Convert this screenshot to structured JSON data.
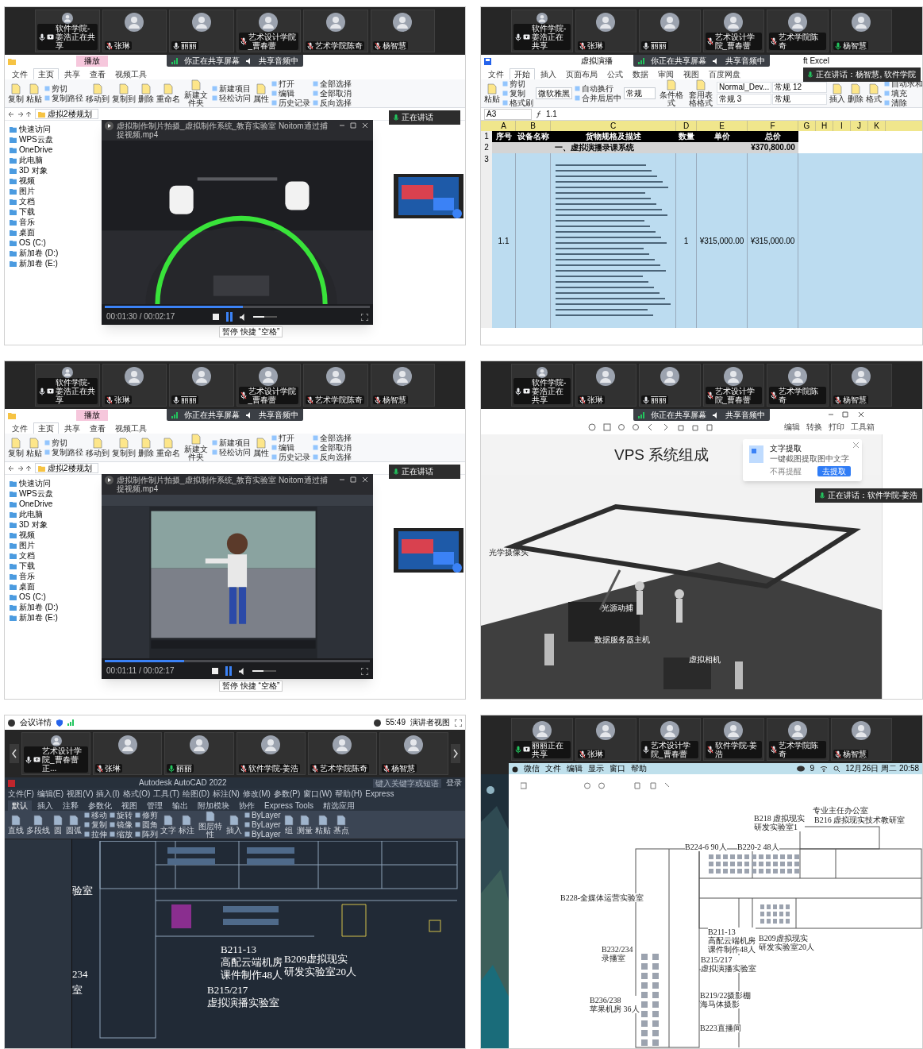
{
  "panels": [
    {
      "kind": "explorer_video",
      "participants": [
        {
          "name": "软件学院-姜浩正在共享",
          "muted": false,
          "speaking": false,
          "sharing": true
        },
        {
          "name": "张琳",
          "muted": true,
          "speaking": false,
          "sharing": false
        },
        {
          "name": "丽丽",
          "muted": false,
          "speaking": false,
          "sharing": false
        },
        {
          "name": "艺术设计学院_曹春蕾",
          "muted": true,
          "speaking": false,
          "sharing": false
        },
        {
          "name": "艺术学院陈奇",
          "muted": true,
          "speaking": false,
          "sharing": false
        },
        {
          "name": "杨智慧",
          "muted": true,
          "speaking": false,
          "sharing": false
        }
      ],
      "share_banner": [
        "你正在共享屏幕",
        "共享音频中"
      ],
      "context_tab": "播放",
      "ribbon_tabs": [
        {
          "label": "文件",
          "selected": false
        },
        {
          "label": "主页",
          "selected": true
        },
        {
          "label": "共享",
          "selected": false
        },
        {
          "label": "查看",
          "selected": false
        },
        {
          "label": "视频工具",
          "selected": false
        }
      ],
      "ribbon": [
        {
          "kind": "large",
          "label": "复制"
        },
        {
          "kind": "large",
          "label": "粘贴"
        },
        {
          "kind": "stack",
          "items": [
            "剪切",
            "复制路径"
          ]
        },
        {
          "kind": "large",
          "label": "移动到"
        },
        {
          "kind": "large",
          "label": "复制到"
        },
        {
          "kind": "large",
          "label": "删除"
        },
        {
          "kind": "large",
          "label": "重命名"
        },
        {
          "kind": "large",
          "label": "新建文件夹"
        },
        {
          "kind": "stack",
          "items": [
            "新建项目",
            "轻松访问"
          ]
        },
        {
          "kind": "large",
          "label": "属性"
        },
        {
          "kind": "stack",
          "items": [
            "打开",
            "编辑",
            "历史记录"
          ]
        },
        {
          "kind": "stack",
          "items": [
            "全部选择",
            "全部取消",
            "反向选择"
          ]
        }
      ],
      "address": "虚拟2楼规划",
      "nav_items": [
        "快速访问",
        "WPS云盘",
        "OneDrive",
        "此电脑",
        "3D 对象",
        "视频",
        "图片",
        "文档",
        "下载",
        "音乐",
        "桌面",
        "OS (C:)",
        "新加卷 (D:)",
        "新加卷 (E:)"
      ],
      "player": {
        "title": "虚拟制作制片拍摄_虚拟制作系统_教育实验室 Noitom通过捕捉视频.mp4",
        "time": "00:01:30 / 00:02:17",
        "progress": {
          "level": 0.52
        },
        "volume": {
          "level": 0.45
        },
        "tooltip": "暂停 快捷 “空格”"
      },
      "speaking_toast": "正在讲话"
    },
    {
      "kind": "spreadsheet",
      "participants": [
        {
          "name": "软件学院-姜浩正在共享",
          "muted": false,
          "speaking": false,
          "sharing": true
        },
        {
          "name": "张琳",
          "muted": true,
          "speaking": false,
          "sharing": false
        },
        {
          "name": "丽丽",
          "muted": false,
          "speaking": false,
          "sharing": false
        },
        {
          "name": "艺术设计学院_曹春蕾",
          "muted": true,
          "speaking": false,
          "sharing": false
        },
        {
          "name": "艺术学院陈奇",
          "muted": true,
          "speaking": false,
          "sharing": false
        },
        {
          "name": "杨智慧",
          "muted": false,
          "speaking": true,
          "sharing": false
        }
      ],
      "share_banner": [
        "你正在共享屏幕",
        "共享音频中"
      ],
      "title_parts": [
        "虚拟演播",
        "ft Excel"
      ],
      "ribbon_tabs": [
        {
          "label": "文件",
          "selected": false
        },
        {
          "label": "开始",
          "selected": true
        },
        {
          "label": "插入",
          "selected": false
        },
        {
          "label": "页面布局",
          "selected": false
        },
        {
          "label": "公式",
          "selected": false
        },
        {
          "label": "数据",
          "selected": false
        },
        {
          "label": "审阅",
          "selected": false
        },
        {
          "label": "视图",
          "selected": false
        },
        {
          "label": "百度网盘",
          "selected": false
        }
      ],
      "ribbon": [
        {
          "kind": "large",
          "label": "粘贴"
        },
        {
          "kind": "stack",
          "items": [
            "剪切",
            "复制",
            "格式刷"
          ]
        },
        {
          "kind": "field",
          "label": "微软雅黑"
        },
        {
          "kind": "stack",
          "items": [
            "自动换行",
            "合并后居中"
          ]
        },
        {
          "kind": "field",
          "label": "常规"
        },
        {
          "kind": "large",
          "label": "条件格式"
        },
        {
          "kind": "large",
          "label": "套用表格格式"
        },
        {
          "kind": "styles",
          "items": [
            "Normal_Dev...",
            "常规 12",
            "常规 3",
            "常规"
          ]
        },
        {
          "kind": "large",
          "label": "插入"
        },
        {
          "kind": "large",
          "label": "删除"
        },
        {
          "kind": "large",
          "label": "格式"
        },
        {
          "kind": "stack",
          "items": [
            "自动求和",
            "填充",
            "清除"
          ]
        }
      ],
      "name_box": "A3",
      "formula": "1.1",
      "sheet": {
        "column_letters": [
          "A",
          "B",
          "C",
          "D",
          "E",
          "F",
          "G",
          "H",
          "I",
          "J",
          "K"
        ],
        "row_numbers": [
          "1",
          "2",
          "3"
        ],
        "header": [
          "序号",
          "设备名称",
          "货物规格及描述",
          "数量",
          "单价",
          "总价"
        ],
        "section": {
          "title": "一、虚拟演播录课系统",
          "total": "¥370,800.00"
        },
        "rows": [
          {
            "cells": [
              "1.1",
              "",
              "",
              "1",
              "¥315,000.00",
              "¥315,000.00"
            ],
            "selected": true
          }
        ]
      },
      "speaking_toast": "正在讲话：杨智慧, 软件学院"
    },
    {
      "kind": "explorer_video",
      "participants": [
        {
          "name": "软件学院-姜浩正在共享",
          "muted": false,
          "speaking": false,
          "sharing": true
        },
        {
          "name": "张琳",
          "muted": true,
          "speaking": false,
          "sharing": false
        },
        {
          "name": "丽丽",
          "muted": false,
          "speaking": false,
          "sharing": false
        },
        {
          "name": "艺术设计学院_曹春蕾",
          "muted": true,
          "speaking": false,
          "sharing": false
        },
        {
          "name": "艺术学院陈奇",
          "muted": true,
          "speaking": false,
          "sharing": false
        },
        {
          "name": "杨智慧",
          "muted": true,
          "speaking": false,
          "sharing": false
        }
      ],
      "share_banner": [
        "你正在共享屏幕",
        "共享音频中"
      ],
      "context_tab": "播放",
      "ribbon_tabs": [
        {
          "label": "文件",
          "selected": false
        },
        {
          "label": "主页",
          "selected": true
        },
        {
          "label": "共享",
          "selected": false
        },
        {
          "label": "查看",
          "selected": false
        },
        {
          "label": "视频工具",
          "selected": false
        }
      ],
      "ribbon": [
        {
          "kind": "large",
          "label": "复制"
        },
        {
          "kind": "large",
          "label": "粘贴"
        },
        {
          "kind": "stack",
          "items": [
            "剪切",
            "复制路径"
          ]
        },
        {
          "kind": "large",
          "label": "移动到"
        },
        {
          "kind": "large",
          "label": "复制到"
        },
        {
          "kind": "large",
          "label": "删除"
        },
        {
          "kind": "large",
          "label": "重命名"
        },
        {
          "kind": "large",
          "label": "新建文件夹"
        },
        {
          "kind": "stack",
          "items": [
            "新建项目",
            "轻松访问"
          ]
        },
        {
          "kind": "large",
          "label": "属性"
        },
        {
          "kind": "stack",
          "items": [
            "打开",
            "编辑",
            "历史记录"
          ]
        },
        {
          "kind": "stack",
          "items": [
            "全部选择",
            "全部取消",
            "反向选择"
          ]
        }
      ],
      "address": "虚拟2楼规划",
      "nav_items": [
        "快速访问",
        "WPS云盘",
        "OneDrive",
        "此电脑",
        "3D 对象",
        "视频",
        "图片",
        "文档",
        "下载",
        "音乐",
        "桌面",
        "OS (C:)",
        "新加卷 (D:)",
        "新加卷 (E:)"
      ],
      "player": {
        "title": "虚拟制作制片拍摄_虚拟制作系统_教育实验室 Noitom通过捕捉视频.mp4",
        "time": "00:01:11 / 00:02:17",
        "progress": {
          "level": 0.3
        },
        "volume": {
          "level": 0.45
        },
        "tooltip": "暂停 快捷 “空格”"
      },
      "speaking_toast": "正在讲话"
    },
    {
      "kind": "pdf_slide",
      "participants": [
        {
          "name": "软件学院-姜浩正在共享",
          "muted": false,
          "speaking": false,
          "sharing": true
        },
        {
          "name": "张琳",
          "muted": true,
          "speaking": false,
          "sharing": false
        },
        {
          "name": "丽丽",
          "muted": false,
          "speaking": false,
          "sharing": false
        },
        {
          "name": "艺术设计学院_曹春蕾",
          "muted": true,
          "speaking": false,
          "sharing": false
        },
        {
          "name": "艺术学院陈奇",
          "muted": true,
          "speaking": false,
          "sharing": false
        },
        {
          "name": "杨智慧",
          "muted": true,
          "speaking": false,
          "sharing": false
        }
      ],
      "share_banner": [
        "你正在共享屏幕",
        "共享音频中"
      ],
      "toolbar_buttons": [
        "编辑",
        "转换",
        "打印",
        "工具箱"
      ],
      "slide_title": "VPS 系统组成",
      "callouts": [
        "光学摄像头",
        "光源动捕",
        "数据服务器主机",
        "虚拟相机"
      ],
      "popup": {
        "title": "文字提取",
        "text": "一键截图提取图中文字",
        "dismiss": "不再提醒",
        "action": "去提取"
      },
      "speaking_toast": "正在讲话：软件学院-姜浩"
    },
    {
      "kind": "cad",
      "top_bar": {
        "meeting": "会议详情",
        "timer": "55:49",
        "view": "演讲者视图"
      },
      "scrollable": true,
      "participants": [
        {
          "name": "艺术设计学院_曹春蕾正...",
          "muted": false,
          "speaking": false,
          "sharing": true
        },
        {
          "name": "张琳",
          "muted": true,
          "speaking": false,
          "sharing": false
        },
        {
          "name": "丽丽",
          "muted": false,
          "speaking": true,
          "sharing": false
        },
        {
          "name": "软件学院-姜浩",
          "muted": true,
          "speaking": false,
          "sharing": false
        },
        {
          "name": "艺术学院陈奇",
          "muted": true,
          "speaking": false,
          "sharing": false
        },
        {
          "name": "杨智慧",
          "muted": true,
          "speaking": false,
          "sharing": false
        }
      ],
      "app_title": "Autodesk AutoCAD 2022",
      "search_placeholder": "键入关键字或短语",
      "sign_in": "登录",
      "menu": [
        "文件(F)",
        "编辑(E)",
        "视图(V)",
        "插入(I)",
        "格式(O)",
        "工具(T)",
        "绘图(D)",
        "标注(N)",
        "修改(M)",
        "参数(P)",
        "窗口(W)",
        "帮助(H)",
        "Express"
      ],
      "ribbon_tabs": [
        {
          "label": "默认",
          "selected": true
        },
        {
          "label": "插入",
          "selected": false
        },
        {
          "label": "注释",
          "selected": false
        },
        {
          "label": "参数化",
          "selected": false
        },
        {
          "label": "视图",
          "selected": false
        },
        {
          "label": "管理",
          "selected": false
        },
        {
          "label": "输出",
          "selected": false
        },
        {
          "label": "附加模块",
          "selected": false
        },
        {
          "label": "协作",
          "selected": false
        },
        {
          "label": "Express Tools",
          "selected": false
        },
        {
          "label": "精选应用",
          "selected": false
        }
      ],
      "ribbon": [
        {
          "kind": "large",
          "label": "直线"
        },
        {
          "kind": "large",
          "label": "多段线"
        },
        {
          "kind": "large",
          "label": "圆"
        },
        {
          "kind": "large",
          "label": "圆弧"
        },
        {
          "kind": "stack",
          "items": [
            "移动",
            "复制",
            "拉伸"
          ]
        },
        {
          "kind": "stack",
          "items": [
            "旋转",
            "镜像",
            "缩放"
          ]
        },
        {
          "kind": "stack",
          "items": [
            "修剪",
            "圆角",
            "阵列"
          ]
        },
        {
          "kind": "large",
          "label": "文字"
        },
        {
          "kind": "large",
          "label": "标注"
        },
        {
          "kind": "large",
          "label": "图层特性"
        },
        {
          "kind": "large",
          "label": "插入"
        },
        {
          "kind": "stack",
          "items": [
            "ByLayer",
            "ByLayer",
            "ByLayer"
          ]
        },
        {
          "kind": "large",
          "label": "组"
        },
        {
          "kind": "large",
          "label": "测量"
        },
        {
          "kind": "large",
          "label": "粘贴"
        },
        {
          "kind": "large",
          "label": "基点"
        }
      ],
      "drawing_labels": [
        [
          "验室"
        ],
        [
          "234"
        ],
        [
          "室"
        ],
        [
          "B211-13",
          "高配云端机房",
          "课件制作48人"
        ],
        [
          "B209虚拟现实",
          "研发实验室20人"
        ],
        [
          "B215/217",
          "虚拟演播实验室"
        ]
      ]
    },
    {
      "kind": "floorplan",
      "participants": [
        {
          "name": "丽丽正在共享",
          "muted": false,
          "speaking": true,
          "sharing": true
        },
        {
          "name": "张琳",
          "muted": true,
          "speaking": false,
          "sharing": false
        },
        {
          "name": "艺术设计学院_曹春蕾",
          "muted": false,
          "speaking": false,
          "sharing": false
        },
        {
          "name": "软件学院-姜浩",
          "muted": true,
          "speaking": false,
          "sharing": false
        },
        {
          "name": "艺术学院陈奇",
          "muted": true,
          "speaking": false,
          "sharing": false
        },
        {
          "name": "杨智慧",
          "muted": true,
          "speaking": false,
          "sharing": false
        }
      ],
      "menubar": {
        "items": [
          "微信",
          "文件",
          "编辑",
          "显示",
          "窗口",
          "帮助"
        ],
        "badge": "9",
        "clock": "12月26日 周二 20:58"
      },
      "labels": [
        [
          "专业主任办公室"
        ],
        [
          "B218 虚拟现实",
          "研发实验室1"
        ],
        [
          "B216 虚拟现实技术教研室"
        ],
        [
          "B224-6 90人"
        ],
        [
          "B220-2 48人"
        ],
        [
          "B228-全媒体运营实验室"
        ],
        [
          "B211-13",
          "高配云端机房",
          "课件制作48人"
        ],
        [
          "B209虚拟现实",
          "研发实验室20人"
        ],
        [
          "B215/217",
          "虚拟演播实验室"
        ],
        [
          "B232/234",
          "录播室"
        ],
        [
          "B236/238",
          "苹果机房 36人"
        ],
        [
          "B219/22摄影棚",
          "海马体摄影"
        ],
        [
          "B223直播间"
        ]
      ]
    }
  ]
}
